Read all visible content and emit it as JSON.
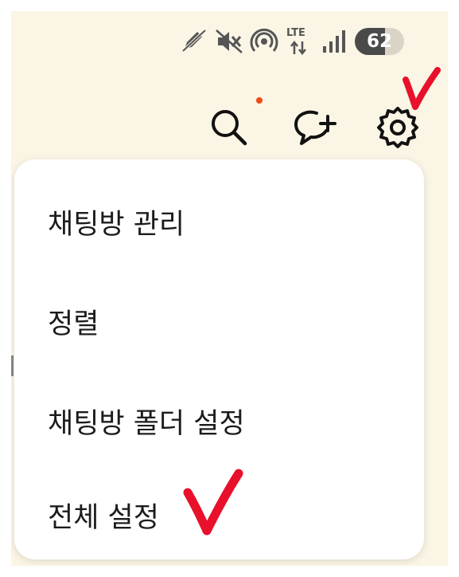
{
  "status_bar": {
    "network": "LTE",
    "battery_percent": 62,
    "battery_label": "62"
  },
  "toolbar": {
    "search_icon": "search-icon",
    "new_chat_icon": "chat-plus-icon",
    "settings_icon": "gear-icon",
    "notification_dot_color": "#f04a16"
  },
  "menu": {
    "items": [
      {
        "label": "채팅방 관리"
      },
      {
        "label": "정렬"
      },
      {
        "label": "채팅방 폴더 설정"
      },
      {
        "label": "전체 설정"
      }
    ]
  },
  "annotations": {
    "color": "#e8102a",
    "marks": [
      "check-mark",
      "check-mark"
    ]
  }
}
